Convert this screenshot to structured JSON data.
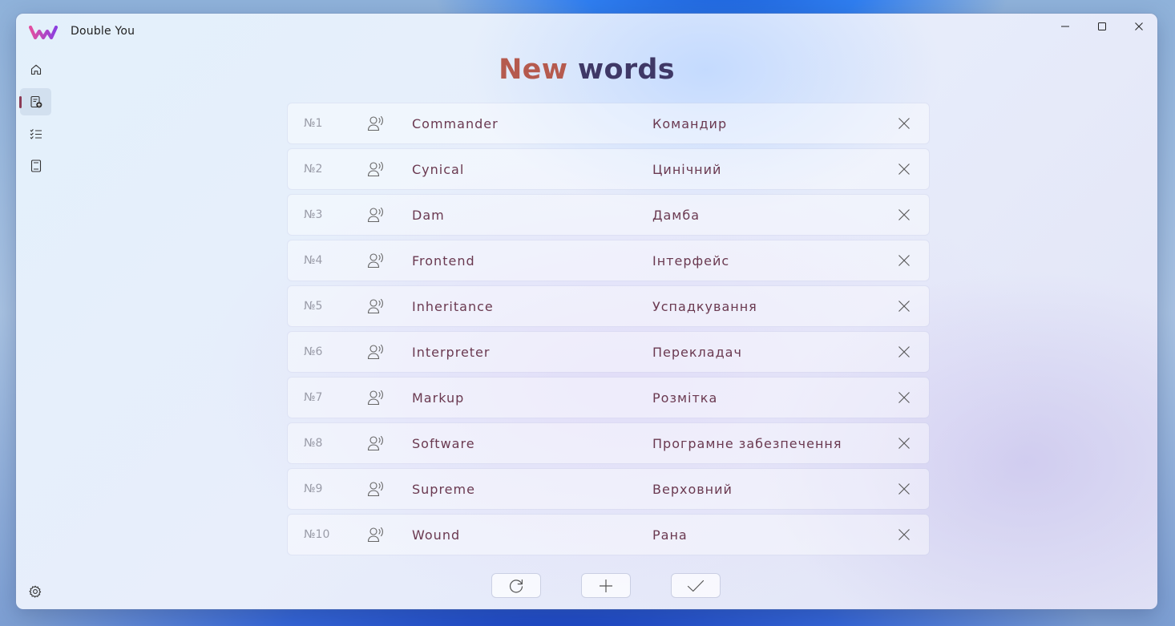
{
  "app": {
    "title": "Double You"
  },
  "page": {
    "title_part1": "New",
    "title_part2": "words"
  },
  "words": [
    {
      "num": "№1",
      "word": "Commander",
      "translation": "Командир"
    },
    {
      "num": "№2",
      "word": "Cynical",
      "translation": "Цинічний"
    },
    {
      "num": "№3",
      "word": "Dam",
      "translation": "Дамба"
    },
    {
      "num": "№4",
      "word": "Frontend",
      "translation": "Інтерфейс"
    },
    {
      "num": "№5",
      "word": "Inheritance",
      "translation": "Успадкування"
    },
    {
      "num": "№6",
      "word": "Interpreter",
      "translation": "Перекладач"
    },
    {
      "num": "№7",
      "word": "Markup",
      "translation": "Розмітка"
    },
    {
      "num": "№8",
      "word": "Software",
      "translation": "Програмне забезпечення"
    },
    {
      "num": "№9",
      "word": "Supreme",
      "translation": "Верховний"
    },
    {
      "num": "№10",
      "word": "Wound",
      "translation": "Рана"
    }
  ],
  "icons": {
    "nav": [
      "home-icon",
      "new-words-icon",
      "checklist-icon",
      "book-icon"
    ],
    "settings": "gear-icon",
    "row_speak": "speak-icon",
    "row_remove": "close-icon",
    "actions": [
      "refresh-icon",
      "plus-icon",
      "check-icon"
    ]
  },
  "colors": {
    "accent": "#8c3a55",
    "title_new": "#b55a4e",
    "title_words": "#3f3866",
    "word_text": "#6a3950"
  }
}
